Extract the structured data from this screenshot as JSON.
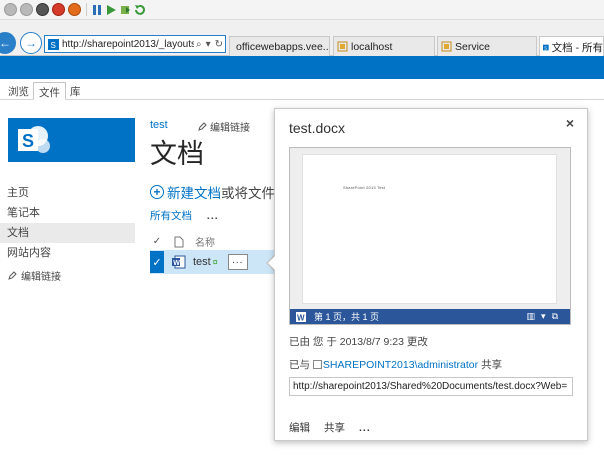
{
  "browser": {
    "address": "http://sharepoint2013/_layouts",
    "tabs": [
      {
        "label": "officewebapps.vee..."
      },
      {
        "label": "localhost"
      },
      {
        "label": "Service"
      },
      {
        "label": "文档 - 所有"
      }
    ]
  },
  "ribbon": {
    "tabs": [
      {
        "label": "浏览"
      },
      {
        "label": "文件"
      },
      {
        "label": "库"
      }
    ]
  },
  "nav": {
    "items": [
      {
        "label": "主页"
      },
      {
        "label": "笔记本"
      },
      {
        "label": "文档"
      },
      {
        "label": "网站内容"
      }
    ],
    "edit_link": "编辑链接"
  },
  "main": {
    "breadcrumb": "test",
    "edit_link": "编辑链接",
    "title": "文档",
    "new_doc": "新建文档",
    "new_doc_rest": "或将文件",
    "view": "所有文档",
    "more": "...",
    "col_name": "名称",
    "row": {
      "name": "test",
      "new_badge": "¤",
      "ellipsis": "..."
    }
  },
  "callout": {
    "title": "test.docx",
    "close": "×",
    "preview": {
      "page_text": "SharePoint 2013 Test",
      "status": "第 1 页，共 1 页"
    },
    "modified": "已由 您 于 2013/8/7 9:23 更改",
    "shared_prefix": "已与",
    "shared_user": "SHAREPOINT2013\\administrator",
    "shared_suffix": "共享",
    "url": "http://sharepoint2013/Shared%20Documents/test.docx?Web=",
    "actions": {
      "edit": "编辑",
      "share": "共享",
      "more": "..."
    }
  },
  "colors": {
    "brand": "#0072c6",
    "selected_row": "#cde6f7",
    "word_bar": "#2b579a"
  }
}
